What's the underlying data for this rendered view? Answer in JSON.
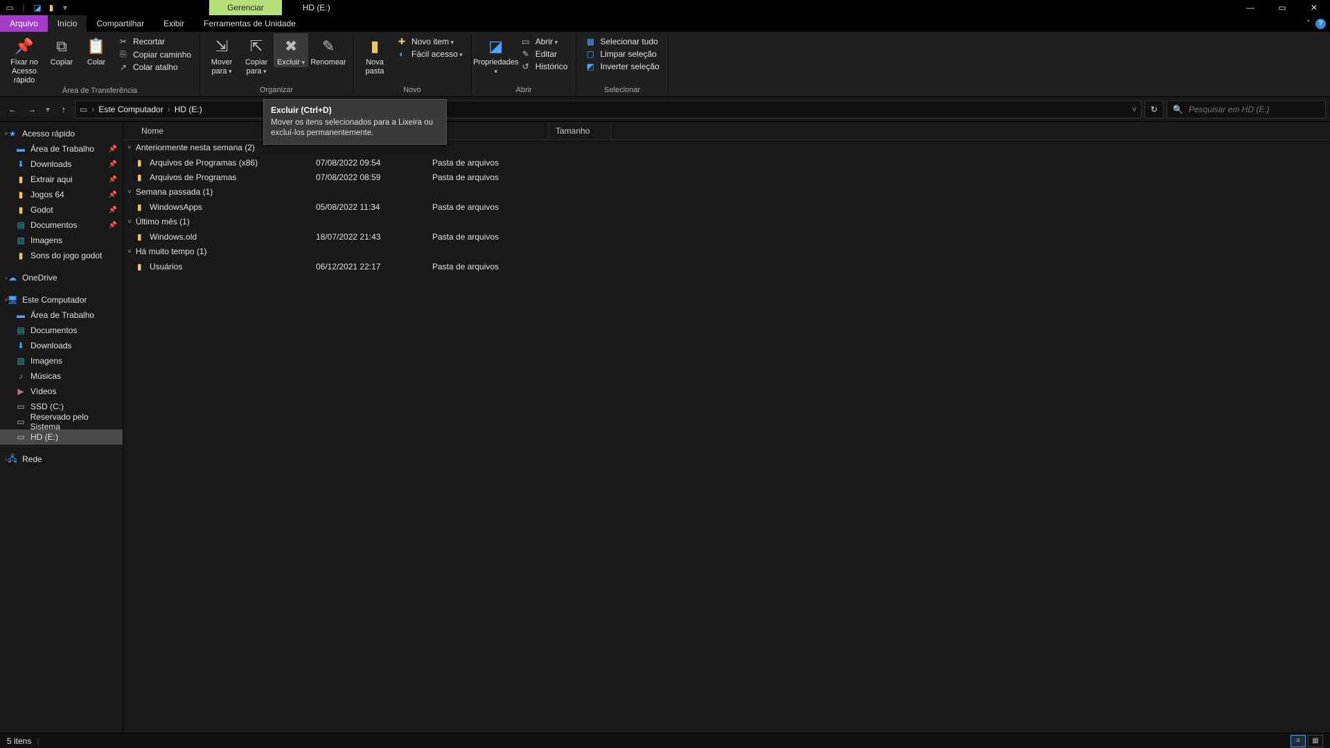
{
  "window": {
    "context_tab": "Gerenciar",
    "title": "HD (E:)",
    "minimize": "—",
    "maximize": "▭",
    "close": "✕"
  },
  "menutabs": {
    "file": "Arquivo",
    "home": "Início",
    "share": "Compartilhar",
    "view": "Exibir",
    "drive_tools": "Ferramentas de Unidade",
    "collapse": "ˆ"
  },
  "ribbon": {
    "pin": "Fixar no\nAcesso rápido",
    "copy": "Copiar",
    "paste": "Colar",
    "cut": "Recortar",
    "copy_path": "Copiar caminho",
    "paste_shortcut": "Colar atalho",
    "group_clipboard": "Área de Transferência",
    "move_to": "Mover\npara",
    "copy_to": "Copiar\npara",
    "delete": "Excluir",
    "rename": "Renomear",
    "group_organize": "Organizar",
    "new_folder": "Nova\npasta",
    "new_item": "Novo item",
    "easy_access": "Fácil acesso",
    "group_new": "Novo",
    "properties": "Propriedades",
    "open": "Abrir",
    "edit": "Editar",
    "history": "Histórico",
    "group_open": "Abrir",
    "select_all": "Selecionar tudo",
    "select_none": "Limpar seleção",
    "invert_sel": "Inverter seleção",
    "group_select": "Selecionar"
  },
  "tooltip": {
    "title": "Excluir (Ctrl+D)",
    "body": "Mover os itens selecionados para a Lixeira ou excluí-los permanentemente."
  },
  "address": {
    "root": "Este Computador",
    "here": "HD (E:)",
    "search_placeholder": "Pesquisar em HD (E:)"
  },
  "columns": {
    "name": "Nome",
    "size": "Tamanho"
  },
  "navpane": {
    "quick": "Acesso rápido",
    "desktop": "Área de Trabalho",
    "downloads": "Downloads",
    "extract": "Extrair aqui",
    "games": "Jogos 64",
    "godot": "Godot",
    "documents": "Documentos",
    "pictures": "Imagens",
    "godot_sounds": "Sons do jogo godot",
    "onedrive": "OneDrive",
    "this_pc": "Este Computador",
    "pc_desktop": "Área de Trabalho",
    "pc_documents": "Documentos",
    "pc_downloads": "Downloads",
    "pc_pictures": "Imagens",
    "pc_music": "Músicas",
    "pc_videos": "Vídeos",
    "pc_ssd": "SSD (C:)",
    "pc_reserved": "Reservado pelo Sistema",
    "pc_hd": "HD (E:)",
    "network": "Rede"
  },
  "groups": [
    {
      "title": "Anteriormente nesta semana (2)",
      "rows": [
        {
          "name": "Arquivos de Programas (x86)",
          "date": "07/08/2022 09:54",
          "type": "Pasta de arquivos"
        },
        {
          "name": "Arquivos de Programas",
          "date": "07/08/2022 08:59",
          "type": "Pasta de arquivos"
        }
      ]
    },
    {
      "title": "Semana passada (1)",
      "rows": [
        {
          "name": "WindowsApps",
          "date": "05/08/2022 11:34",
          "type": "Pasta de arquivos"
        }
      ]
    },
    {
      "title": "Último mês (1)",
      "rows": [
        {
          "name": "Windows.old",
          "date": "18/07/2022 21:43",
          "type": "Pasta de arquivos"
        }
      ]
    },
    {
      "title": "Há muito tempo (1)",
      "rows": [
        {
          "name": "Usuários",
          "date": "06/12/2021 22:17",
          "type": "Pasta de arquivos"
        }
      ]
    }
  ],
  "status": {
    "count": "5 itens"
  }
}
